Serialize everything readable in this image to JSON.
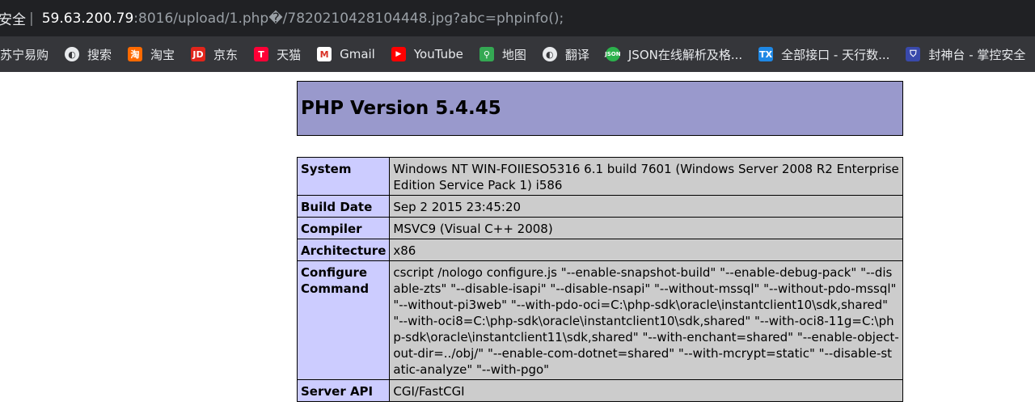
{
  "address_bar": {
    "security_label": "安全",
    "divider": "|",
    "host": "59.63.200.79",
    "path": ":8016/upload/1.php�/7820210428104448.jpg?abc=phpinfo();"
  },
  "bookmarks": [
    {
      "label": "苏宁易购",
      "icon": "suning-icon"
    },
    {
      "label": "搜索",
      "icon": "globe-icon"
    },
    {
      "label": "淘宝",
      "icon": "taobao-icon"
    },
    {
      "label": "京东",
      "icon": "jd-icon"
    },
    {
      "label": "天猫",
      "icon": "tmall-icon"
    },
    {
      "label": "Gmail",
      "icon": "gmail-icon"
    },
    {
      "label": "YouTube",
      "icon": "youtube-icon"
    },
    {
      "label": "地图",
      "icon": "maps-icon"
    },
    {
      "label": "翻译",
      "icon": "globe-icon"
    },
    {
      "label": "JSON在线解析及格...",
      "icon": "json-icon"
    },
    {
      "label": "全部接口 - 天行数...",
      "icon": "tianxing-icon"
    },
    {
      "label": "封神台 - 掌控安全",
      "icon": "shield-icon"
    }
  ],
  "php": {
    "title": "PHP Version 5.4.45",
    "rows": [
      {
        "key": "System",
        "value": "Windows NT WIN-FOIIESO5316 6.1 build 7601 (Windows Server 2008 R2 Enterprise Edition Service Pack 1) i586"
      },
      {
        "key": "Build Date",
        "value": "Sep 2 2015 23:45:20"
      },
      {
        "key": "Compiler",
        "value": "MSVC9 (Visual C++ 2008)"
      },
      {
        "key": "Architecture",
        "value": "x86"
      },
      {
        "key": "Configure Command",
        "value": "cscript /nologo configure.js \"--enable-snapshot-build\" \"--enable-debug-pack\" \"--disable-zts\" \"--disable-isapi\" \"--disable-nsapi\" \"--without-mssql\" \"--without-pdo-mssql\" \"--without-pi3web\" \"--with-pdo-oci=C:\\php-sdk\\oracle\\instantclient10\\sdk,shared\" \"--with-oci8=C:\\php-sdk\\oracle\\instantclient10\\sdk,shared\" \"--with-oci8-11g=C:\\php-sdk\\oracle\\instantclient11\\sdk,shared\" \"--with-enchant=shared\" \"--enable-object-out-dir=../obj/\" \"--enable-com-dotnet=shared\" \"--with-mcrypt=static\" \"--disable-static-analyze\" \"--with-pgo\""
      },
      {
        "key": "Server API",
        "value": "CGI/FastCGI"
      }
    ]
  },
  "colors": {
    "header_bg": "#9999cc",
    "key_bg": "#ccccff",
    "value_bg": "#cccccc"
  }
}
